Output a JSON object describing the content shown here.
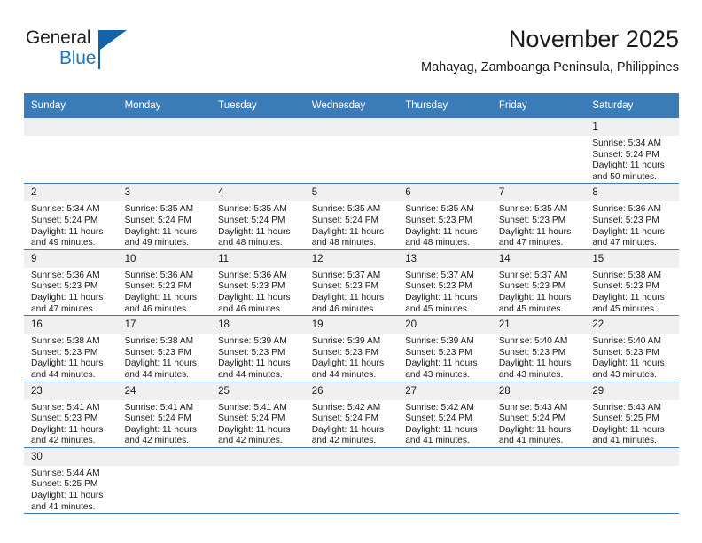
{
  "logo": {
    "line1": "General",
    "line2": "Blue",
    "accent_color": "#1463a8"
  },
  "header": {
    "title": "November 2025",
    "subtitle": "Mahayag, Zamboanga Peninsula, Philippines"
  },
  "calendar": {
    "header_bg": "#3b7cb8",
    "daynum_bg": "#f0f0f0",
    "weekdays": [
      "Sunday",
      "Monday",
      "Tuesday",
      "Wednesday",
      "Thursday",
      "Friday",
      "Saturday"
    ],
    "weeks": [
      [
        {
          "day": "",
          "sunrise": "",
          "sunset": "",
          "daylight1": "",
          "daylight2": "",
          "empty": true
        },
        {
          "day": "",
          "sunrise": "",
          "sunset": "",
          "daylight1": "",
          "daylight2": "",
          "empty": true
        },
        {
          "day": "",
          "sunrise": "",
          "sunset": "",
          "daylight1": "",
          "daylight2": "",
          "empty": true
        },
        {
          "day": "",
          "sunrise": "",
          "sunset": "",
          "daylight1": "",
          "daylight2": "",
          "empty": true
        },
        {
          "day": "",
          "sunrise": "",
          "sunset": "",
          "daylight1": "",
          "daylight2": "",
          "empty": true
        },
        {
          "day": "",
          "sunrise": "",
          "sunset": "",
          "daylight1": "",
          "daylight2": "",
          "empty": true
        },
        {
          "day": "1",
          "sunrise": "Sunrise: 5:34 AM",
          "sunset": "Sunset: 5:24 PM",
          "daylight1": "Daylight: 11 hours",
          "daylight2": "and 50 minutes."
        }
      ],
      [
        {
          "day": "2",
          "sunrise": "Sunrise: 5:34 AM",
          "sunset": "Sunset: 5:24 PM",
          "daylight1": "Daylight: 11 hours",
          "daylight2": "and 49 minutes."
        },
        {
          "day": "3",
          "sunrise": "Sunrise: 5:35 AM",
          "sunset": "Sunset: 5:24 PM",
          "daylight1": "Daylight: 11 hours",
          "daylight2": "and 49 minutes."
        },
        {
          "day": "4",
          "sunrise": "Sunrise: 5:35 AM",
          "sunset": "Sunset: 5:24 PM",
          "daylight1": "Daylight: 11 hours",
          "daylight2": "and 48 minutes."
        },
        {
          "day": "5",
          "sunrise": "Sunrise: 5:35 AM",
          "sunset": "Sunset: 5:24 PM",
          "daylight1": "Daylight: 11 hours",
          "daylight2": "and 48 minutes."
        },
        {
          "day": "6",
          "sunrise": "Sunrise: 5:35 AM",
          "sunset": "Sunset: 5:23 PM",
          "daylight1": "Daylight: 11 hours",
          "daylight2": "and 48 minutes."
        },
        {
          "day": "7",
          "sunrise": "Sunrise: 5:35 AM",
          "sunset": "Sunset: 5:23 PM",
          "daylight1": "Daylight: 11 hours",
          "daylight2": "and 47 minutes."
        },
        {
          "day": "8",
          "sunrise": "Sunrise: 5:36 AM",
          "sunset": "Sunset: 5:23 PM",
          "daylight1": "Daylight: 11 hours",
          "daylight2": "and 47 minutes."
        }
      ],
      [
        {
          "day": "9",
          "sunrise": "Sunrise: 5:36 AM",
          "sunset": "Sunset: 5:23 PM",
          "daylight1": "Daylight: 11 hours",
          "daylight2": "and 47 minutes."
        },
        {
          "day": "10",
          "sunrise": "Sunrise: 5:36 AM",
          "sunset": "Sunset: 5:23 PM",
          "daylight1": "Daylight: 11 hours",
          "daylight2": "and 46 minutes."
        },
        {
          "day": "11",
          "sunrise": "Sunrise: 5:36 AM",
          "sunset": "Sunset: 5:23 PM",
          "daylight1": "Daylight: 11 hours",
          "daylight2": "and 46 minutes."
        },
        {
          "day": "12",
          "sunrise": "Sunrise: 5:37 AM",
          "sunset": "Sunset: 5:23 PM",
          "daylight1": "Daylight: 11 hours",
          "daylight2": "and 46 minutes."
        },
        {
          "day": "13",
          "sunrise": "Sunrise: 5:37 AM",
          "sunset": "Sunset: 5:23 PM",
          "daylight1": "Daylight: 11 hours",
          "daylight2": "and 45 minutes."
        },
        {
          "day": "14",
          "sunrise": "Sunrise: 5:37 AM",
          "sunset": "Sunset: 5:23 PM",
          "daylight1": "Daylight: 11 hours",
          "daylight2": "and 45 minutes."
        },
        {
          "day": "15",
          "sunrise": "Sunrise: 5:38 AM",
          "sunset": "Sunset: 5:23 PM",
          "daylight1": "Daylight: 11 hours",
          "daylight2": "and 45 minutes."
        }
      ],
      [
        {
          "day": "16",
          "sunrise": "Sunrise: 5:38 AM",
          "sunset": "Sunset: 5:23 PM",
          "daylight1": "Daylight: 11 hours",
          "daylight2": "and 44 minutes."
        },
        {
          "day": "17",
          "sunrise": "Sunrise: 5:38 AM",
          "sunset": "Sunset: 5:23 PM",
          "daylight1": "Daylight: 11 hours",
          "daylight2": "and 44 minutes."
        },
        {
          "day": "18",
          "sunrise": "Sunrise: 5:39 AM",
          "sunset": "Sunset: 5:23 PM",
          "daylight1": "Daylight: 11 hours",
          "daylight2": "and 44 minutes."
        },
        {
          "day": "19",
          "sunrise": "Sunrise: 5:39 AM",
          "sunset": "Sunset: 5:23 PM",
          "daylight1": "Daylight: 11 hours",
          "daylight2": "and 44 minutes."
        },
        {
          "day": "20",
          "sunrise": "Sunrise: 5:39 AM",
          "sunset": "Sunset: 5:23 PM",
          "daylight1": "Daylight: 11 hours",
          "daylight2": "and 43 minutes."
        },
        {
          "day": "21",
          "sunrise": "Sunrise: 5:40 AM",
          "sunset": "Sunset: 5:23 PM",
          "daylight1": "Daylight: 11 hours",
          "daylight2": "and 43 minutes."
        },
        {
          "day": "22",
          "sunrise": "Sunrise: 5:40 AM",
          "sunset": "Sunset: 5:23 PM",
          "daylight1": "Daylight: 11 hours",
          "daylight2": "and 43 minutes."
        }
      ],
      [
        {
          "day": "23",
          "sunrise": "Sunrise: 5:41 AM",
          "sunset": "Sunset: 5:23 PM",
          "daylight1": "Daylight: 11 hours",
          "daylight2": "and 42 minutes."
        },
        {
          "day": "24",
          "sunrise": "Sunrise: 5:41 AM",
          "sunset": "Sunset: 5:24 PM",
          "daylight1": "Daylight: 11 hours",
          "daylight2": "and 42 minutes."
        },
        {
          "day": "25",
          "sunrise": "Sunrise: 5:41 AM",
          "sunset": "Sunset: 5:24 PM",
          "daylight1": "Daylight: 11 hours",
          "daylight2": "and 42 minutes."
        },
        {
          "day": "26",
          "sunrise": "Sunrise: 5:42 AM",
          "sunset": "Sunset: 5:24 PM",
          "daylight1": "Daylight: 11 hours",
          "daylight2": "and 42 minutes."
        },
        {
          "day": "27",
          "sunrise": "Sunrise: 5:42 AM",
          "sunset": "Sunset: 5:24 PM",
          "daylight1": "Daylight: 11 hours",
          "daylight2": "and 41 minutes."
        },
        {
          "day": "28",
          "sunrise": "Sunrise: 5:43 AM",
          "sunset": "Sunset: 5:24 PM",
          "daylight1": "Daylight: 11 hours",
          "daylight2": "and 41 minutes."
        },
        {
          "day": "29",
          "sunrise": "Sunrise: 5:43 AM",
          "sunset": "Sunset: 5:25 PM",
          "daylight1": "Daylight: 11 hours",
          "daylight2": "and 41 minutes."
        }
      ],
      [
        {
          "day": "30",
          "sunrise": "Sunrise: 5:44 AM",
          "sunset": "Sunset: 5:25 PM",
          "daylight1": "Daylight: 11 hours",
          "daylight2": "and 41 minutes."
        },
        {
          "day": "",
          "sunrise": "",
          "sunset": "",
          "daylight1": "",
          "daylight2": "",
          "empty": true
        },
        {
          "day": "",
          "sunrise": "",
          "sunset": "",
          "daylight1": "",
          "daylight2": "",
          "empty": true
        },
        {
          "day": "",
          "sunrise": "",
          "sunset": "",
          "daylight1": "",
          "daylight2": "",
          "empty": true
        },
        {
          "day": "",
          "sunrise": "",
          "sunset": "",
          "daylight1": "",
          "daylight2": "",
          "empty": true
        },
        {
          "day": "",
          "sunrise": "",
          "sunset": "",
          "daylight1": "",
          "daylight2": "",
          "empty": true
        },
        {
          "day": "",
          "sunrise": "",
          "sunset": "",
          "daylight1": "",
          "daylight2": "",
          "empty": true
        }
      ]
    ]
  }
}
